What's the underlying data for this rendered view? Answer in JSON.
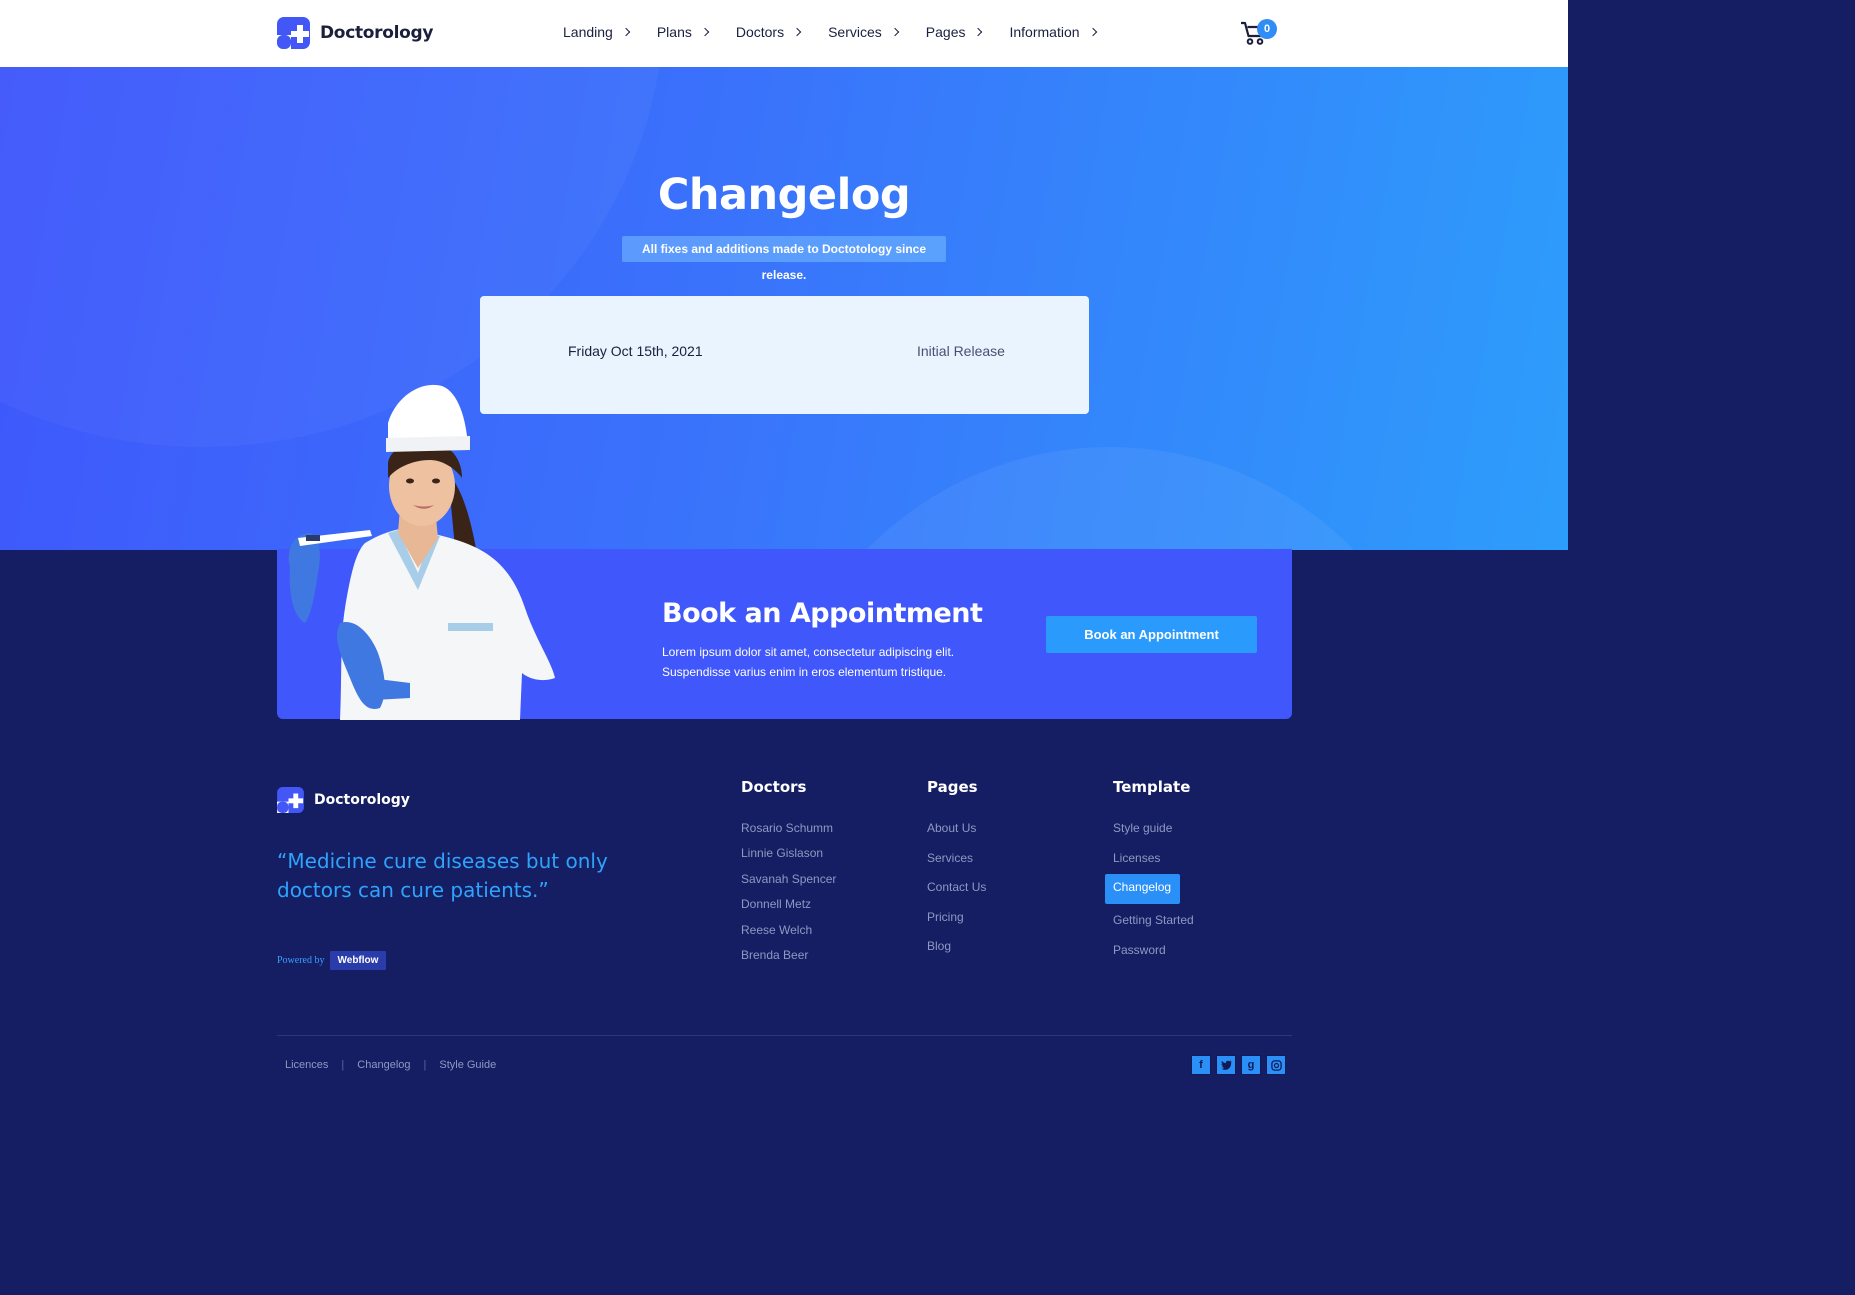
{
  "header": {
    "brand": "Doctorology",
    "nav": [
      {
        "label": "Landing"
      },
      {
        "label": "Plans"
      },
      {
        "label": "Doctors"
      },
      {
        "label": "Services"
      },
      {
        "label": "Pages"
      },
      {
        "label": "Information"
      }
    ],
    "cart_count": "0"
  },
  "hero": {
    "title": "Changelog",
    "subtitle": "All fixes and additions made to Doctotology since release.",
    "release": {
      "date": "Friday Oct 15th, 2021",
      "note": "Initial Release"
    }
  },
  "appointment": {
    "title": "Book an Appointment",
    "text": "Lorem ipsum dolor sit amet, consectetur adipiscing elit. Suspendisse varius enim in eros elementum tristique.",
    "button": "Book an Appointment"
  },
  "footer": {
    "brand": "Doctorology",
    "quote": "“Medicine cure diseases but only doctors can cure patients.”",
    "powered_by": "Powered by",
    "webflow": "Webflow",
    "columns": {
      "doctors": {
        "title": "Doctors",
        "links": [
          "Rosario Schumm",
          "Linnie Gislason",
          "Savanah Spencer",
          "Donnell Metz",
          "Reese Welch",
          "Brenda Beer"
        ]
      },
      "pages": {
        "title": "Pages",
        "links": [
          "About Us",
          "Services",
          "Contact Us",
          "Pricing",
          "Blog"
        ]
      },
      "template": {
        "title": "Template",
        "links": [
          "Style guide",
          "Licenses",
          "Changelog",
          "Getting Started",
          "Password"
        ]
      }
    },
    "bottom_links": [
      "Licences",
      "Changelog",
      "Style Guide"
    ],
    "socials": [
      "facebook-icon",
      "twitter-icon",
      "google-plus-icon",
      "instagram-icon"
    ]
  },
  "colors": {
    "primary": "#4057fb",
    "accent": "#2a9bfc",
    "footer_bg": "#161e63"
  }
}
